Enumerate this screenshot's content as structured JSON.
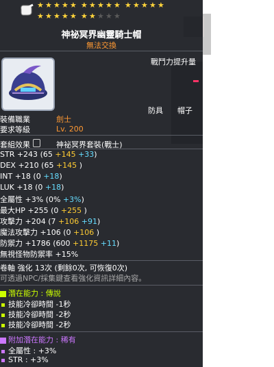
{
  "item": {
    "name": "神祕冥界幽靈騎士帽",
    "trade": "無法交換",
    "power_up": "戰鬥力提升量",
    "category_tags": [
      "防具",
      "帽子"
    ],
    "job_label": "裝備職業",
    "job_value": "劍士",
    "level_label": "要求等級",
    "level_value": "Lv. 200",
    "set_label": "套組效果",
    "set_name": "神祕冥界套裝(戰士)",
    "stars_filled": 22,
    "stars_total": 25
  },
  "stats": [
    {
      "label": "STR",
      "total": "+243",
      "base": "(65",
      "a": "+145",
      "b": "+33",
      "end": ")"
    },
    {
      "label": "DEX",
      "total": "+210",
      "base": "(65",
      "a": "+145",
      "b": "",
      "end": ")"
    },
    {
      "label": "INT",
      "total": "+18",
      "base": "(0",
      "a": "",
      "b": "+18",
      "end": ")"
    },
    {
      "label": "LUK",
      "total": "+18",
      "base": "(0",
      "a": "",
      "b": "+18",
      "end": ")"
    },
    {
      "label": "全屬性",
      "total": "+3%",
      "base": "(0%",
      "a": "",
      "b": "+3%",
      "end": ")"
    },
    {
      "label": "最大HP",
      "total": "+255",
      "base": "(0",
      "a": "+255",
      "b": "",
      "end": ")"
    },
    {
      "label": "攻擊力",
      "total": "+204",
      "base": "(7",
      "a": "+106",
      "b": "+91",
      "end": ")"
    },
    {
      "label": "魔法攻擊力",
      "total": "+106",
      "base": "(0",
      "a": "+106",
      "b": "",
      "end": ")"
    },
    {
      "label": "防禦力",
      "total": "+1786",
      "base": "(600",
      "a": "+1175",
      "b": "+11",
      "end": ")"
    },
    {
      "label": "無視怪物防禦率",
      "total": "+15%",
      "base": "",
      "a": "",
      "b": "",
      "end": ""
    }
  ],
  "scroll": {
    "line": "卷軸 強化 13次 (剩餘0次, 可恢復0次)",
    "hint": "可透過NPC/採集鍵查看強化資訊詳細內容。"
  },
  "potential": {
    "title": "潛在能力 : 傳說",
    "lines": [
      "技能冷卻時間 -1秒",
      "技能冷卻時間 -2秒",
      "技能冷卻時間 -2秒"
    ]
  },
  "bonus": {
    "title": "附加潛在能力 : 稀有",
    "lines": [
      "全屬性 : +3%",
      "STR : +3%"
    ]
  },
  "colors": {
    "star": "#ffd43b",
    "legend": "#ccff00",
    "rare": "#cc77ff",
    "trade": "#ff9933"
  }
}
